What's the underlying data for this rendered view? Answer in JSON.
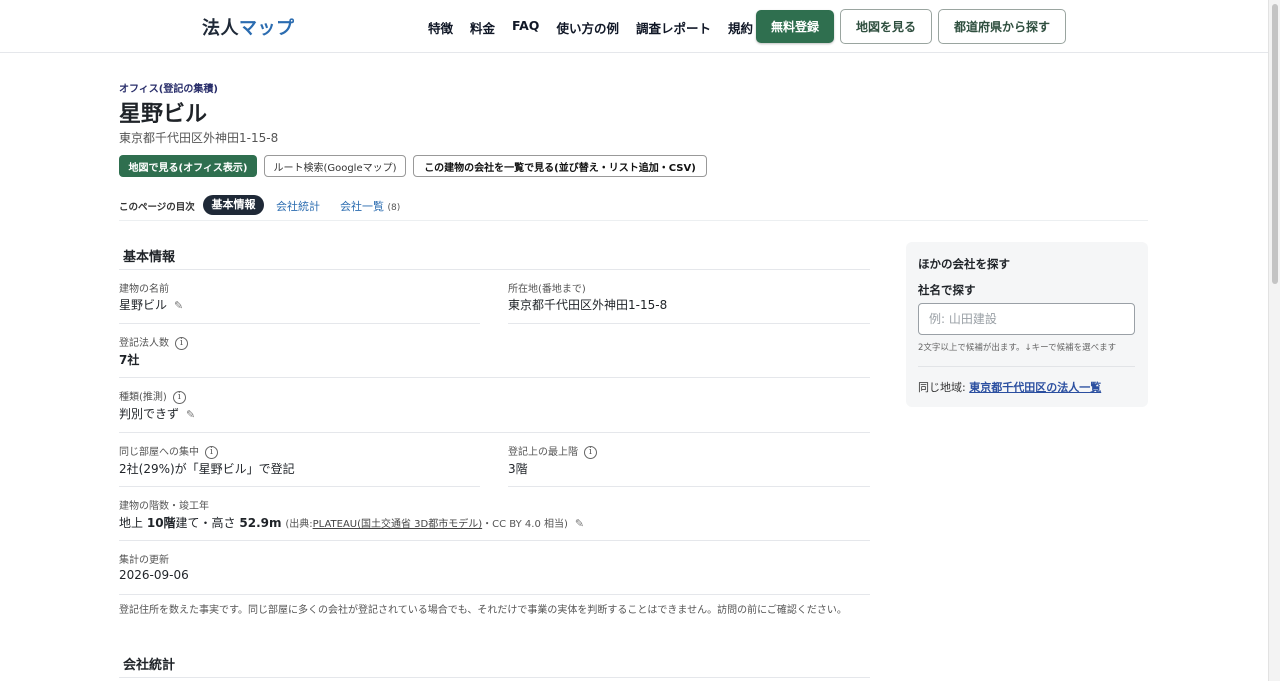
{
  "header": {
    "logo_main": "法人",
    "logo_accent": "マップ",
    "nav": [
      "特徴",
      "料金",
      "FAQ",
      "使い方の例",
      "調査レポート",
      "規約"
    ],
    "signup": "無料登録",
    "view_map": "地図を見る",
    "by_prefecture": "都道府県から探す"
  },
  "building": {
    "category": "オフィス(登記の集積)",
    "name": "星野ビル",
    "address": "東京都千代田区外神田1-15-8"
  },
  "actions": {
    "map_office": "地図で見る(オフィス表示)",
    "route": "ルート検索(Googleマップ)",
    "company_list": "この建物の会社を一覧で見る(並び替え・リスト追加・CSV)"
  },
  "toc": {
    "label": "このページの目次",
    "active": "基本情報",
    "stats": "会社統計",
    "companies": "会社一覧",
    "companies_count": "(8)"
  },
  "basic": {
    "heading": "基本情報",
    "name_label": "建物の名前",
    "name_value": "星野ビル",
    "location_label": "所在地(番地まで)",
    "location_value": "東京都千代田区外神田1-15-8",
    "corp_count_label": "登記法人数",
    "corp_count_value": "7社",
    "type_label": "種類(推測)",
    "type_value": "判別できず",
    "concentration_label": "同じ部屋への集中",
    "concentration_value": "2社(29%)が「星野ビル」で登記",
    "top_floor_label": "登記上の最上階",
    "top_floor_value": "3階",
    "floors_label": "建物の階数・竣工年",
    "floors_prefix": "地上",
    "floors_num": "10階",
    "floors_mid": "建て・高さ",
    "height": "52.9m",
    "source_open": "(出典:",
    "source_link": "PLATEAU(国土交通省 3D都市モデル)",
    "source_close": "・CC BY 4.0 相当)",
    "updated_label": "集計の更新",
    "updated_value": "2026-09-06",
    "note": "登記住所を数えた事実です。同じ部屋に多くの会社が登記されている場合でも、それだけで事業の実体を判断することはできません。訪問の前にご確認ください。"
  },
  "stats": {
    "heading": "会社統計"
  },
  "sidebar": {
    "title": "ほかの会社を探す",
    "search_label": "社名で探す",
    "search_placeholder": "例: 山田建設",
    "hint": "2文字以上で候補が出ます。↓キーで候補を選べます",
    "region_prefix": "同じ地域:",
    "region_link": "東京都千代田区の法人一覧"
  },
  "icons": {
    "info": "info-icon",
    "edit": "pencil-icon"
  },
  "colors": {
    "brand_green": "#2f6f4f",
    "logo_accent": "#2b6cb0",
    "link_blue": "#2b4fa0"
  }
}
